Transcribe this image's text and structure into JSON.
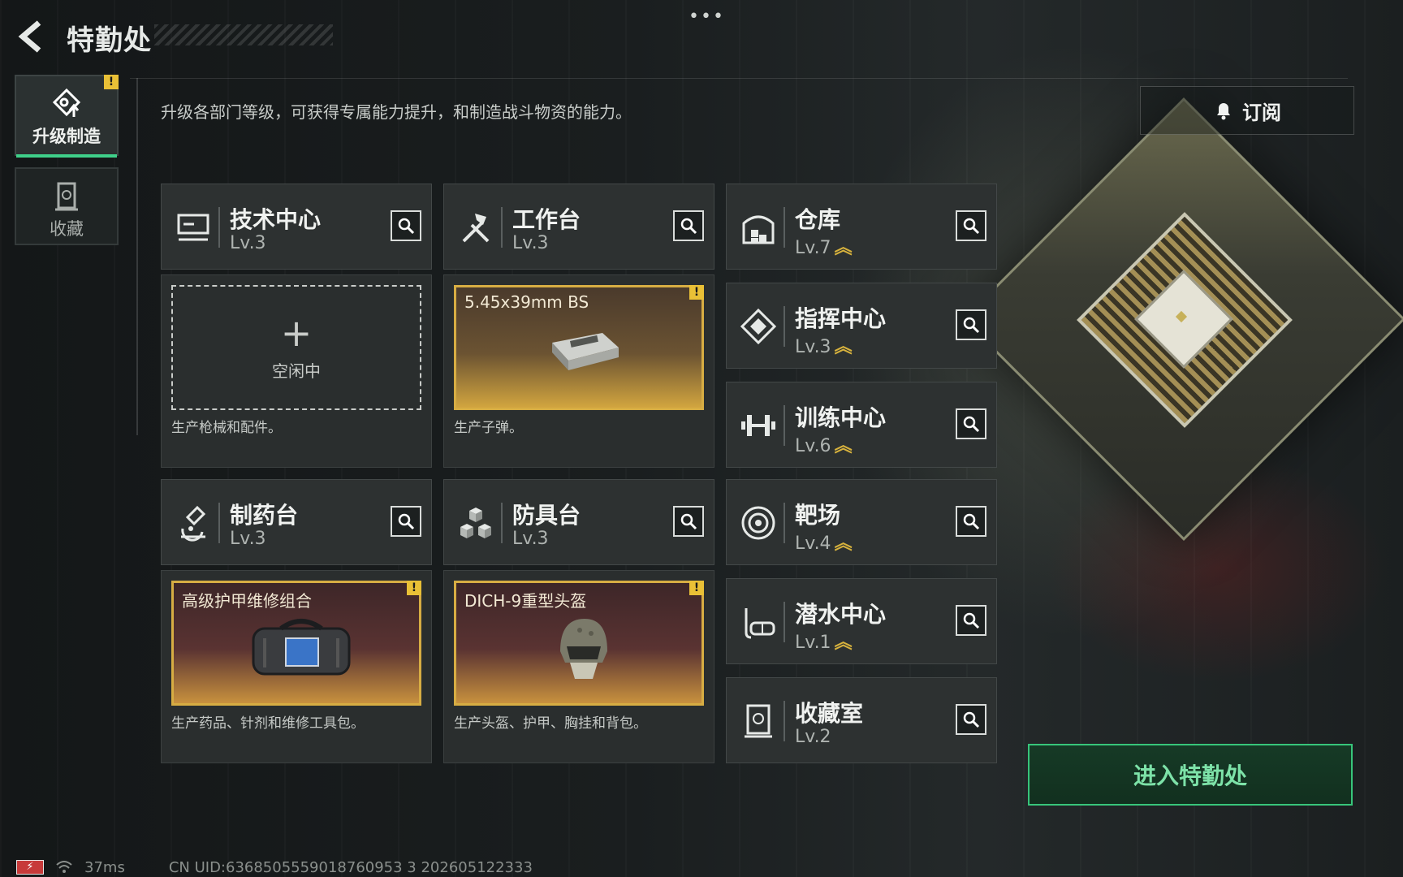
{
  "header": {
    "title": "特勤处",
    "more": "•••"
  },
  "sidebar": {
    "items": [
      {
        "label": "升级制造",
        "badge": "!"
      },
      {
        "label": "收藏"
      }
    ]
  },
  "description": "升级各部门等级，可获得专属能力提升，和制造战斗物资的能力。",
  "subscribe_label": "订阅",
  "workshops": [
    {
      "name": "技术中心",
      "level": "Lv.3",
      "production": {
        "state": "idle",
        "plus": "+",
        "label": "空闲中"
      },
      "note": "生产枪械和配件。"
    },
    {
      "name": "工作台",
      "level": "Lv.3",
      "production": {
        "state": "active",
        "item": "5.45x39mm BS",
        "badge": "!"
      },
      "note": "生产子弹。"
    },
    {
      "name": "制药台",
      "level": "Lv.3",
      "production": {
        "state": "active",
        "item": "高级护甲维修组合",
        "badge": "!"
      },
      "note": "生产药品、针剂和维修工具包。"
    },
    {
      "name": "防具台",
      "level": "Lv.3",
      "production": {
        "state": "active",
        "item": "DICH-9重型头盔",
        "badge": "!"
      },
      "note": "生产头盔、护甲、胸挂和背包。"
    }
  ],
  "facilities": [
    {
      "name": "仓库",
      "level": "Lv.7",
      "upgradable": true
    },
    {
      "name": "指挥中心",
      "level": "Lv.3",
      "upgradable": true
    },
    {
      "name": "训练中心",
      "level": "Lv.6",
      "upgradable": true
    },
    {
      "name": "靶场",
      "level": "Lv.4",
      "upgradable": true
    },
    {
      "name": "潜水中心",
      "level": "Lv.1",
      "upgradable": true
    },
    {
      "name": "收藏室",
      "level": "Lv.2",
      "upgradable": false
    }
  ],
  "upgrade_glyph": "︽",
  "enter_button": "进入特勤处",
  "footer": {
    "battery": "⚡",
    "ping": "37ms",
    "uid": "CN UID:6368505559018760953 3 202605122333"
  },
  "colors": {
    "accent_green": "#37c57a",
    "gold": "#d7ad43",
    "badge_yellow": "#e9c036"
  }
}
